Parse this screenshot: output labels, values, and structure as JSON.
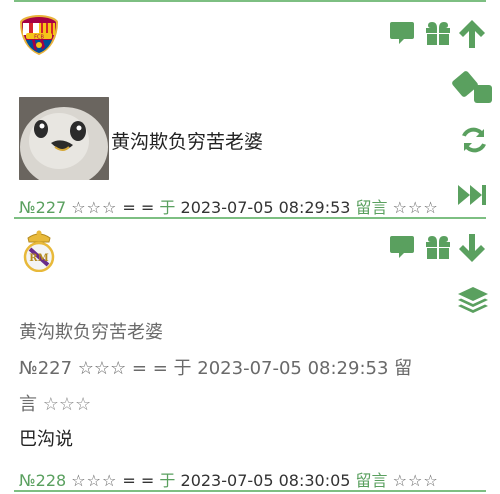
{
  "thread": [
    {
      "team": "FC Barcelona",
      "text": "黄沟欺负穷苦老婆",
      "meta": {
        "id": "№227",
        "stars": "☆☆☆",
        "eq": "= =",
        "yu": "于",
        "time": "2023-07-05 08:29:53",
        "liuyan": "留言",
        "stars2": "☆☆☆"
      }
    },
    {
      "team": "Real Madrid",
      "quote": {
        "text": "黄沟欺负穷苦老婆",
        "line1": "№227 ☆☆☆ = = 于 2023-07-05 08:29:53 留",
        "line2_text": "言",
        "line2_stars": "☆☆☆"
      },
      "text": "巴沟说",
      "meta": {
        "id": "№228",
        "stars": "☆☆☆",
        "eq": "= =",
        "yu": "于",
        "time": "2023-07-05 08:30:05",
        "liuyan": "留言",
        "stars2": "☆☆☆"
      }
    }
  ],
  "icons": {
    "comment": "comment-icon",
    "gift": "gift-icon",
    "up": "arrow-up-icon",
    "down": "arrow-down-icon",
    "dice": "dice-icon",
    "refresh": "refresh-icon",
    "next": "fast-forward-icon",
    "layers": "layers-icon"
  },
  "colors": {
    "accent": "#5aa05f",
    "divider": "#7dbf82"
  }
}
